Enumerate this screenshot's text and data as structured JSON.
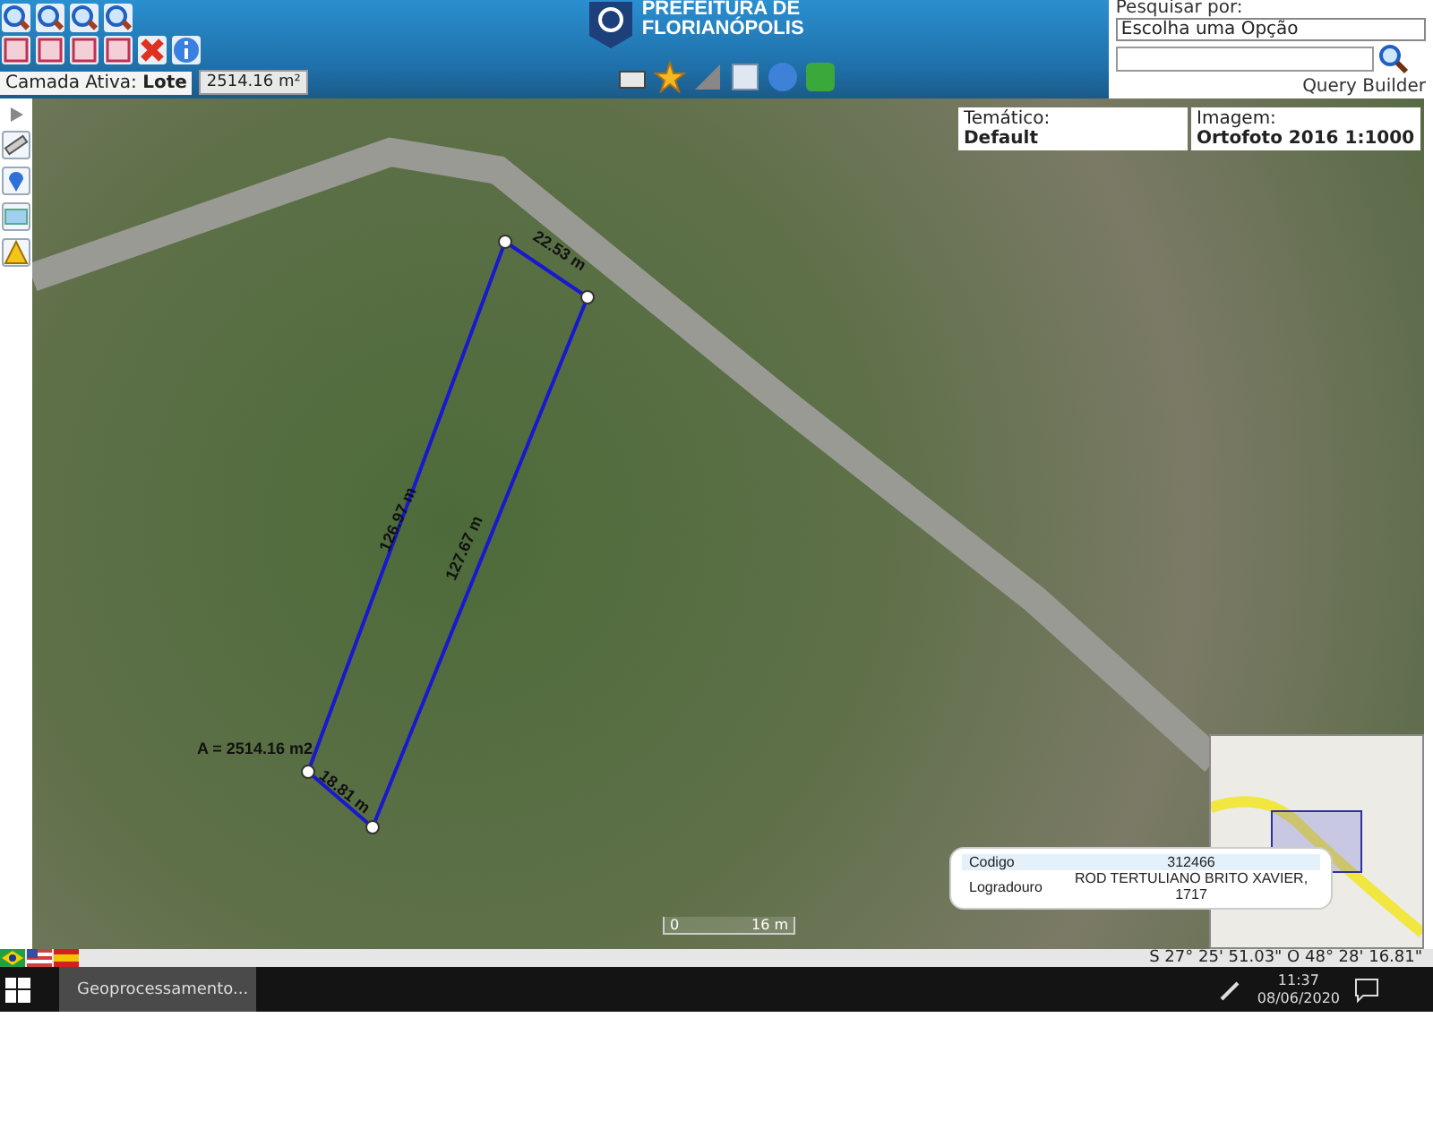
{
  "header": {
    "title_lines": [
      "PREFEITURA DE",
      "FLORIANÓPOLIS"
    ],
    "active_layer": {
      "label": "Camada Ativa:",
      "value": "Lote"
    },
    "area_readout": "2514.16 m²"
  },
  "search": {
    "label": "Pesquisar por:",
    "dropdown": "Escolha uma Opção",
    "link": "Query Builder"
  },
  "map": {
    "thematic": {
      "label": "Temático:",
      "value": "Default"
    },
    "imagery": {
      "label": "Imagem:",
      "value": "Ortofoto 2016 1:1000"
    },
    "measurements": [
      "22.53 m",
      "126.97 m",
      "127.67 m",
      "18.81 m"
    ],
    "area_label": "A = 2514.16 m2",
    "scale": {
      "start": "0",
      "end": "16 m"
    },
    "popup": {
      "rows": [
        {
          "field": "Codigo",
          "value": "312466"
        },
        {
          "field": "Logradouro",
          "value": "ROD TERTULIANO BRITO XAVIER, 1717"
        }
      ]
    }
  },
  "status_bar": {
    "coordinates": "S 27° 25' 51.03\" O 48° 28' 16.81\""
  },
  "taskbar": {
    "tasks": [
      {
        "label": "Geoprocessamento..."
      }
    ],
    "time": "11:37",
    "date": "08/06/2020"
  }
}
